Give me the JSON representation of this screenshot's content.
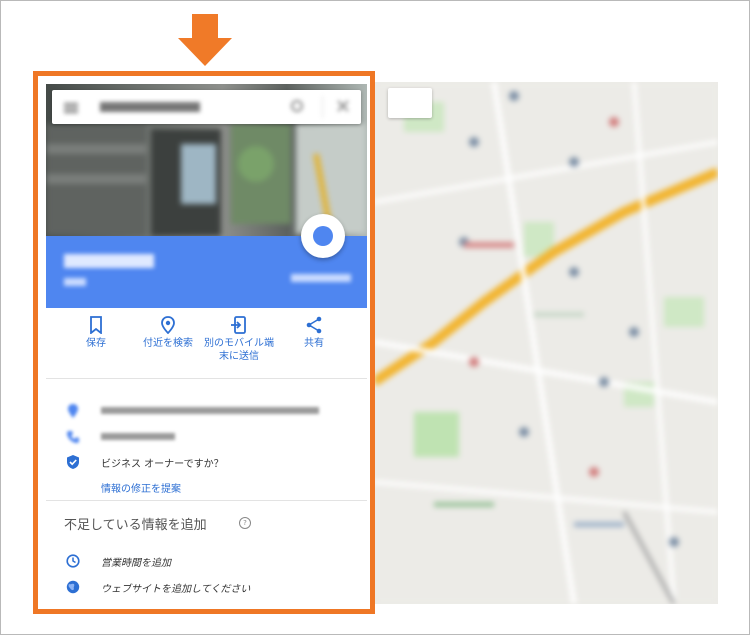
{
  "actions": [
    {
      "label": "保存",
      "icon": "bookmark-icon"
    },
    {
      "label": "付近を検索",
      "icon": "location-pin-icon"
    },
    {
      "label_line1": "別のモバイル端",
      "label_line2": "末に送信",
      "icon": "send-to-device-icon"
    },
    {
      "label": "共有",
      "icon": "share-icon"
    }
  ],
  "info": {
    "business_owner_question": "ビジネス オーナーですか？",
    "suggest_edit_link": "情報の修正を提案"
  },
  "missing_info": {
    "title": "不足している情報を追加",
    "add_hours": "営業時間を追加",
    "add_website": "ウェブサイトを追加してください"
  },
  "colors": {
    "highlight": "#ef7725",
    "accent_blue": "#4f86f0",
    "link_blue": "#2d6fd3"
  }
}
